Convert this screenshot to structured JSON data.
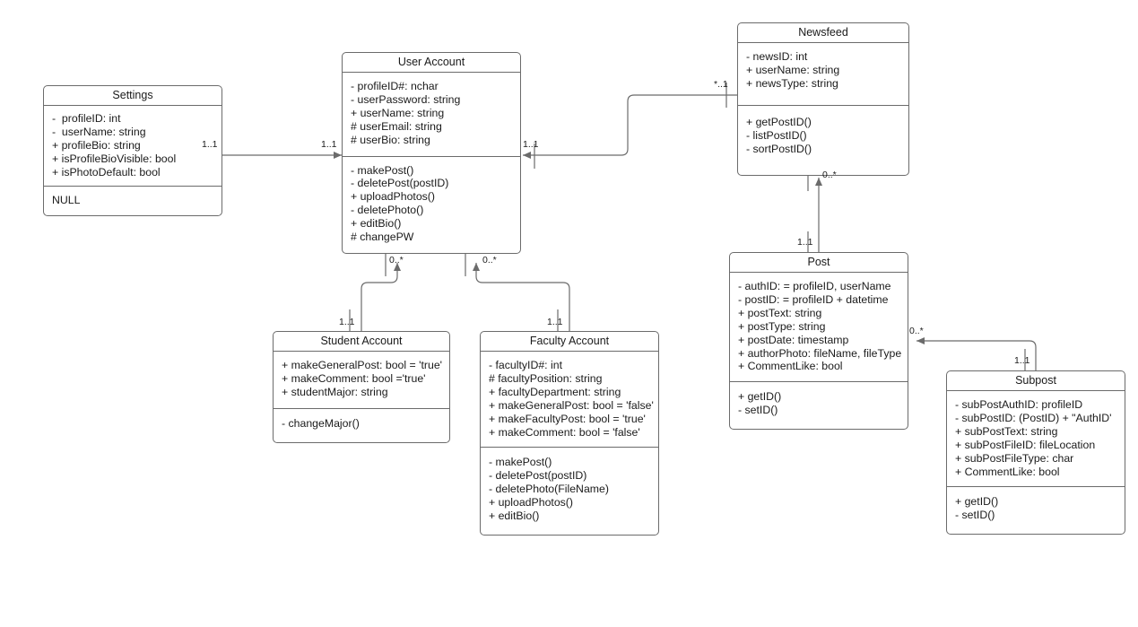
{
  "diagram": {
    "type": "uml-class-diagram",
    "line_color": "#6b6b6b",
    "text_color": "#1a1a1a",
    "background": "#ffffff"
  },
  "classes": {
    "settings": {
      "name": "Settings",
      "attributes": [
        "-  profileID: int",
        "-  userName: string",
        "+ profileBio: string",
        "+ isProfileBioVisible: bool",
        "+ isPhotoDefault: bool"
      ],
      "operations": [
        "NULL"
      ]
    },
    "user_account": {
      "name": "User Account",
      "attributes": [
        "- profileID#: nchar",
        "- userPassword: string",
        "+ userName: string",
        "# userEmail: string",
        "# userBio: string"
      ],
      "operations": [
        "- makePost()",
        "- deletePost(postID)",
        "+ uploadPhotos()",
        "- deletePhoto()",
        "+ editBio()",
        "# changePW"
      ]
    },
    "newsfeed": {
      "name": "Newsfeed",
      "attributes": [
        "- newsID: int",
        "+ userName: string",
        "+ newsType: string"
      ],
      "operations": [
        "+ getPostID()",
        "- listPostID()",
        "- sortPostID()"
      ]
    },
    "post": {
      "name": "Post",
      "attributes": [
        "- authID: = profileID, userName",
        "- postID: = profileID + datetime",
        "+ postText: string",
        "+ postType: string",
        "+ postDate: timestamp",
        "+ authorPhoto: fileName, fileType",
        "+ CommentLike: bool"
      ],
      "operations": [
        "+ getID()",
        "- setID()"
      ]
    },
    "subpost": {
      "name": "Subpost",
      "attributes": [
        "- subPostAuthID: profileID",
        "- subPostID: (PostID) + \"AuthID'",
        "+ subPostText: string",
        "+ subPostFileID: fileLocation",
        "+ subPostFileType: char",
        "+ CommentLike: bool"
      ],
      "operations": [
        "+ getID()",
        "- setID()"
      ]
    },
    "student_account": {
      "name": "Student Account",
      "attributes": [
        "+ makeGeneralPost: bool = 'true'",
        "+ makeComment: bool ='true'",
        "+ studentMajor: string"
      ],
      "operations": [
        "- changeMajor()"
      ]
    },
    "faculty_account": {
      "name": "Faculty Account",
      "attributes": [
        "- facultyID#: int",
        "# facultyPosition: string",
        "+ facultyDepartment: string",
        "+ makeGeneralPost: bool = 'false'",
        "+ makeFacultyPost: bool = 'true'",
        "+ makeComment: bool = 'false'"
      ],
      "operations": [
        "- makePost()",
        "- deletePost(postID)",
        "- deletePhoto(FileName)",
        "+ uploadPhotos()",
        "+ editBio()"
      ]
    }
  },
  "multiplicities": {
    "settings_source": "1..1",
    "settings_target": "1..1",
    "newsfeed_source": "*..1",
    "newsfeed_target": "1..1",
    "student_target": "0..*",
    "student_source": "1..1",
    "faculty_target": "0..*",
    "faculty_source": "1..1",
    "post_target": "0..*",
    "post_source": "1..1",
    "subpost_target": "0..*",
    "subpost_source": "1..1"
  }
}
